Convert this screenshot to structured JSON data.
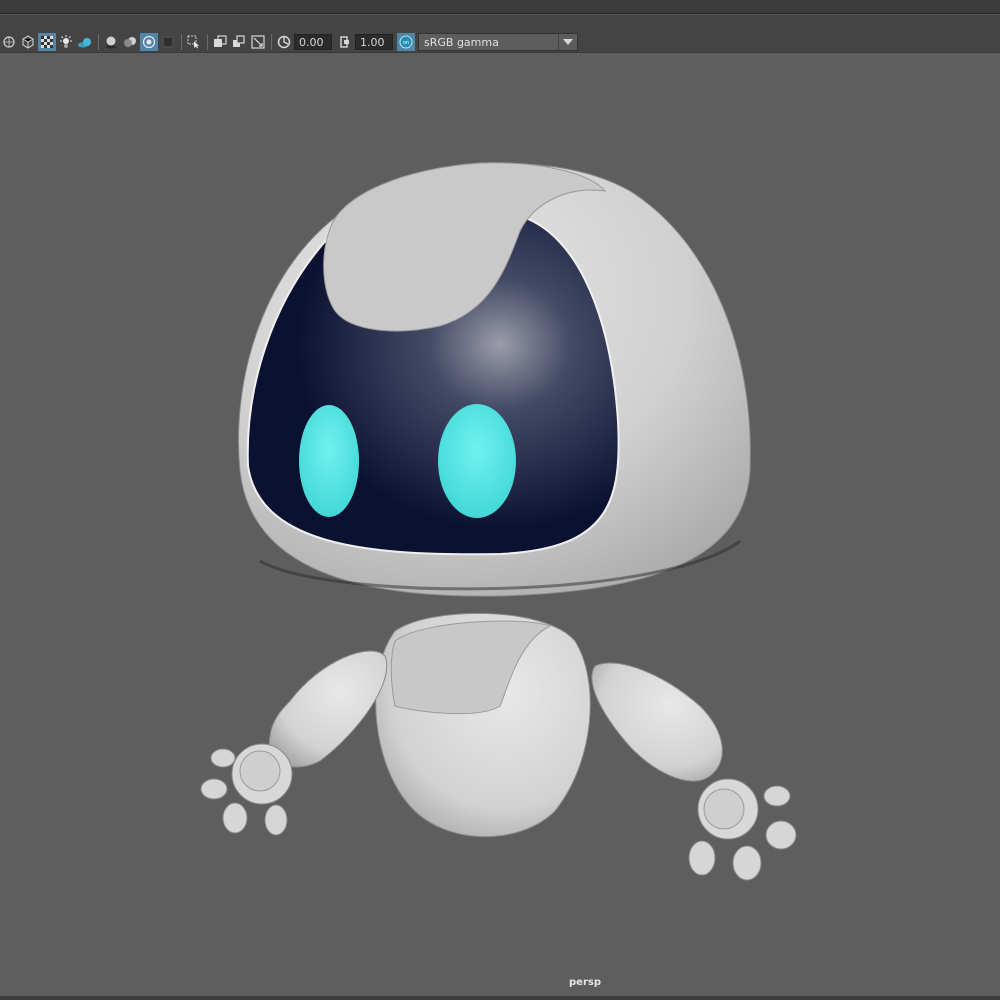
{
  "toolbar": {
    "exposure_value": "0.00",
    "gamma_value": "1.00",
    "color_space": "sRGB gamma"
  },
  "viewport": {
    "camera_label": "persp",
    "model": "robot-character"
  },
  "colors": {
    "viewport_bg": "#5e5e5e",
    "visor": "#0c1233",
    "eyes": "#4fe2e0",
    "shell": "#d4d4d4",
    "active_icon": "#5285a6"
  }
}
